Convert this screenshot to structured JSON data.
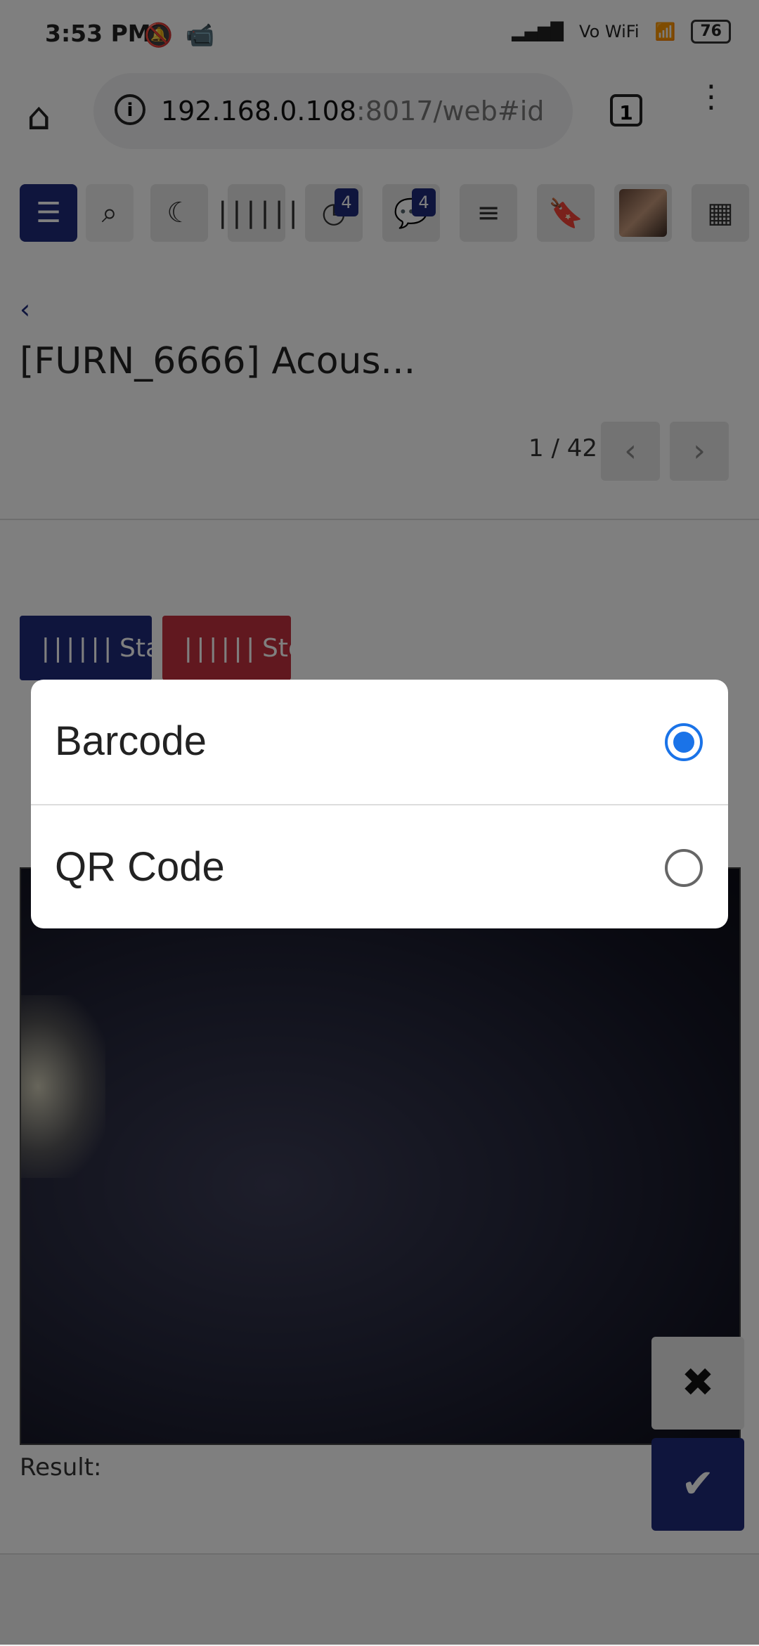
{
  "status_bar": {
    "time": "3:53 PM",
    "battery": "76",
    "volte": "Vo WiFi"
  },
  "browser": {
    "url_main": "192.168.0.108",
    "url_rest": ":8017/web#id",
    "tab_count": "1"
  },
  "toolbar": {
    "activity_badge": "4",
    "messages_badge": "4"
  },
  "record": {
    "title": "[FURN_6666] Acous...",
    "pager": "1 / 42"
  },
  "scanner": {
    "start_label": "Start",
    "stop_label": "Stop",
    "result_label": "Result:"
  },
  "dialog": {
    "options": [
      {
        "label": "Barcode",
        "selected": true
      },
      {
        "label": "QR Code",
        "selected": false
      }
    ]
  }
}
